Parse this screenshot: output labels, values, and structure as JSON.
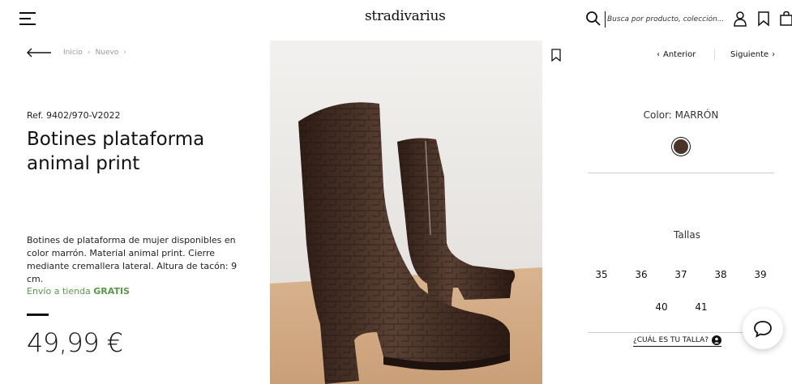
{
  "header": {
    "logo": "stradivarius",
    "search_placeholder": "Busca por producto, colección..."
  },
  "breadcrumb": [
    "Inicio",
    "Nuevo"
  ],
  "product": {
    "ref": "Ref. 9402/970-V2022",
    "title": "Botines plataforma animal print",
    "description": "Botines de plataforma de mujer disponibles en color marrón. Material animal print. Cierre mediante cremallera lateral. Altura de tacón: 9 cm.",
    "shipping_prefix": "Envío a tienda ",
    "shipping_bold": "GRATIS",
    "price": "49,99 €"
  },
  "nav": {
    "prev": "Anterior",
    "next": "Siguiente"
  },
  "color": {
    "label": "Color: MARRÓN",
    "swatch": "#4a342a"
  },
  "sizes": {
    "label": "Tallas",
    "values": [
      "35",
      "36",
      "37",
      "38",
      "39",
      "40",
      "41"
    ]
  },
  "size_guide": "¿CUÁL ES TU TALLA?",
  "colors": {
    "accent_green": "#5a9a4a",
    "text": "#111111"
  }
}
